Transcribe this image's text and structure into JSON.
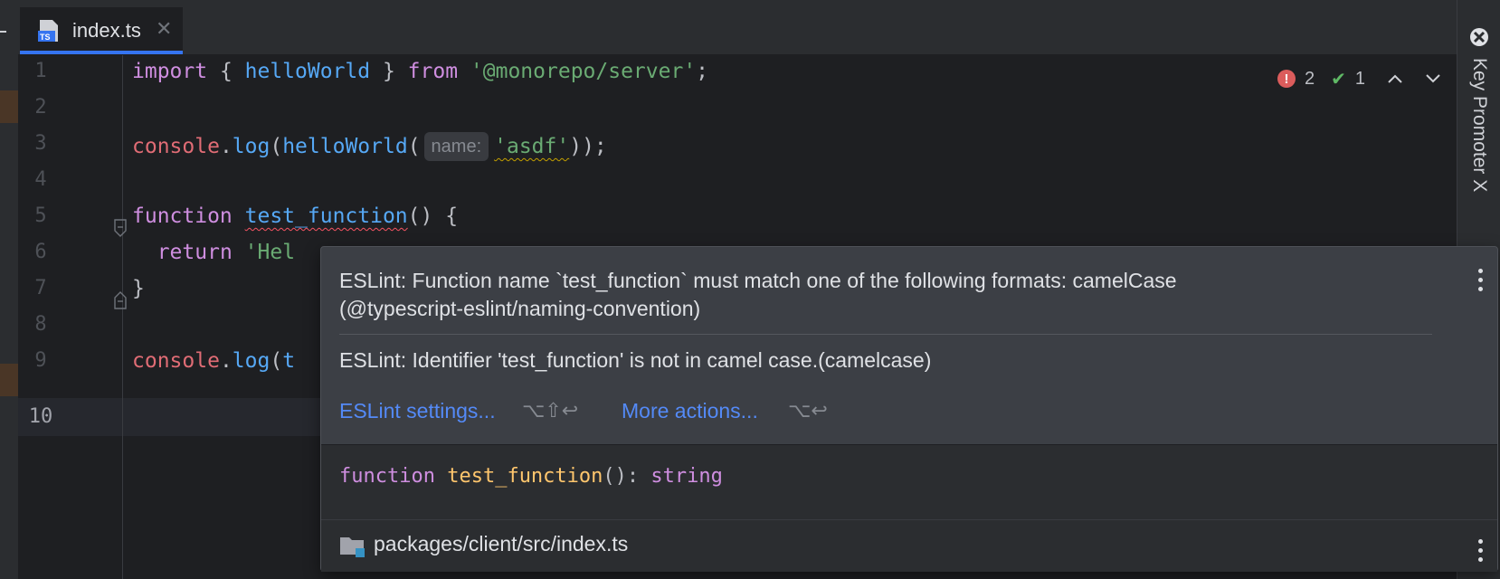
{
  "tab": {
    "label": "index.ts",
    "close": "✕",
    "icon": "typescript-file-icon"
  },
  "right_panel": {
    "label": "Key Promoter X",
    "icon": "key-promoter-icon"
  },
  "editor": {
    "line_numbers": [
      "1",
      "2",
      "3",
      "4",
      "5",
      "6",
      "7",
      "8",
      "9",
      "10"
    ],
    "current_line": "10",
    "inspection_widget": {
      "errors": "2",
      "warnings": "1",
      "error_glyph": "!",
      "check_glyph": "✔",
      "up": "⌃",
      "down": "⌄"
    },
    "lines": {
      "l1": {
        "import": "import",
        "brace_open": " { ",
        "ident": "helloWorld",
        "brace_close": " } ",
        "from": "from",
        "space": " ",
        "module": "'@monorepo/server'",
        "semi": ";"
      },
      "l3": {
        "console": "console",
        "dot": ".",
        "log": "log",
        "paren": "(",
        "fn": "helloWorld",
        "paren2": "(",
        "hint": "name:",
        "arg": "'asdf'",
        "close": "));"
      },
      "l5": {
        "function": "function",
        "space": " ",
        "name": "test_function",
        "rest": "() {"
      },
      "l6": {
        "indent": "  ",
        "return": "return",
        "space": " ",
        "str": "'Hel"
      },
      "l7": {
        "brace": "}"
      },
      "l9": {
        "console": "console",
        "dot": ".",
        "log": "log",
        "paren": "(",
        "partial": "t"
      }
    }
  },
  "popup": {
    "message1_line1": "ESLint: Function name `test_function` must match one of the following formats: camelCase",
    "message1_line2": "(@typescript-eslint/naming-convention)",
    "message2": "ESLint: Identifier 'test_function' is not in camel case.(camelcase)",
    "settings_link": "ESLint settings...",
    "settings_shortcut": "⌥⇧↩",
    "more_link": "More actions...",
    "more_shortcut": "⌥↩",
    "signature": {
      "keyword": "function",
      "space": " ",
      "name": "test_function",
      "params": "(): ",
      "type": "string"
    },
    "path": "packages/client/src/index.ts"
  }
}
